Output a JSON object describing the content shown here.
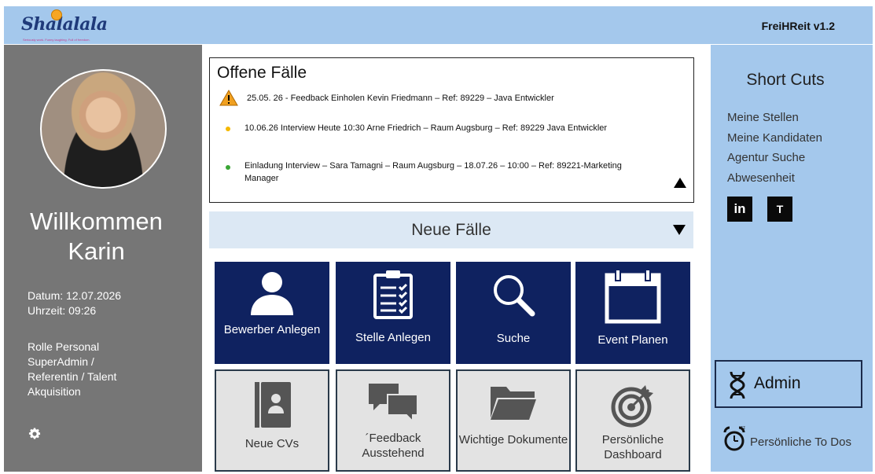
{
  "header": {
    "logo_text": "Shalalala",
    "logo_tagline": "Seriously work. Funny laughing. Full of freedom.",
    "version": "FreiHReit v1.2"
  },
  "profile": {
    "welcome_line1": "Willkommen",
    "welcome_line2": "Karin",
    "date": "Datum: 12.07.2026",
    "time": "Uhrzeit: 09:26",
    "role_lines": [
      "Rolle Personal",
      "SuperAdmin /",
      "Referentin / Talent",
      "Akquisition"
    ]
  },
  "open_cases": {
    "title": "Offene Fälle",
    "items": [
      {
        "status": "warning",
        "color": "#f0a020",
        "text": "25.05. 26 - Feedback Einholen Kevin Friedmann – Ref: 89229 – Java Entwickler"
      },
      {
        "status": "pending",
        "color": "#f5b800",
        "text": "10.06.26  Interview Heute 10:30 Arne Friedrich – Raum Augsburg – Ref: 89229 Java Entwickler"
      },
      {
        "status": "ok",
        "color": "#3aa635",
        "text": "Einladung Interview – Sara Tamagni  – Raum Augsburg – 18.07.26 – 10:00 – Ref: 89221-Marketing Manager"
      }
    ]
  },
  "new_cases": {
    "label": "Neue Fälle"
  },
  "tiles_top": [
    {
      "label": "Bewerber Anlegen",
      "icon": "person-icon"
    },
    {
      "label": "Stelle Anlegen",
      "icon": "clipboard-icon"
    },
    {
      "label": "Suche",
      "icon": "magnifier-icon"
    },
    {
      "label": "Event Planen",
      "icon": "calendar-icon"
    }
  ],
  "tiles_bottom": [
    {
      "label": "Neue CVs",
      "icon": "contact-book-icon"
    },
    {
      "label": "´Feedback Ausstehend",
      "icon": "chat-bubbles-icon"
    },
    {
      "label": "Wichtige Dokumente",
      "icon": "folder-icon"
    },
    {
      "label": "Persönliche Dashboard",
      "icon": "target-icon"
    }
  ],
  "shortcuts": {
    "title": "Short Cuts",
    "items": [
      "Meine Stellen",
      "Meine Kandidaten",
      "Agentur Suche",
      "Abwesenheit"
    ],
    "social": [
      {
        "label": "in",
        "icon": "linkedin-icon"
      },
      {
        "label": "T",
        "icon": "teams-icon"
      }
    ]
  },
  "admin": {
    "label": "Admin",
    "icon": "dna-icon"
  },
  "todo": {
    "label": "Persönliche To Dos",
    "icon": "alarm-clock-icon"
  },
  "colors": {
    "header_bg": "#a4c8ec",
    "sidebar_bg": "#767676",
    "tile_dark": "#0f2260",
    "tile_light": "#e3e3e3"
  }
}
